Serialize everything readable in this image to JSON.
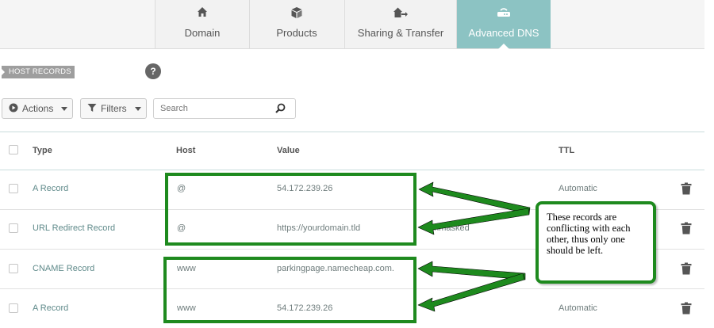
{
  "tabs": [
    {
      "label": "Domain",
      "icon": "home-icon"
    },
    {
      "label": "Products",
      "icon": "box-icon"
    },
    {
      "label": "Sharing & Transfer",
      "icon": "home-transfer-icon"
    },
    {
      "label": "Advanced DNS",
      "icon": "router-icon",
      "active": true
    }
  ],
  "section": {
    "tag": "HOST RECORDS",
    "help": "?"
  },
  "toolbar": {
    "actions_label": "Actions",
    "filters_label": "Filters",
    "search_placeholder": "Search"
  },
  "table": {
    "headers": {
      "type": "Type",
      "host": "Host",
      "value": "Value",
      "ttl": "TTL"
    },
    "rows": [
      {
        "type": "A Record",
        "host": "@",
        "value": "54.172.239.26",
        "extra": "",
        "ttl": "Automatic"
      },
      {
        "type": "URL Redirect Record",
        "host": "@",
        "value": "https://yourdomain.tld",
        "extra": "unmasked",
        "ttl": ""
      },
      {
        "type": "CNAME Record",
        "host": "www",
        "value": "parkingpage.namecheap.com.",
        "extra": "",
        "ttl": ""
      },
      {
        "type": "A Record",
        "host": "www",
        "value": "54.172.239.26",
        "extra": "",
        "ttl": "Automatic"
      }
    ]
  },
  "annotation": {
    "note": "These records are conflicting with each other, thus only one should be left.",
    "color": "#1e8a1e"
  },
  "colors": {
    "active_tab": "#8cc3c3",
    "record_type": "#5f8a8a"
  }
}
